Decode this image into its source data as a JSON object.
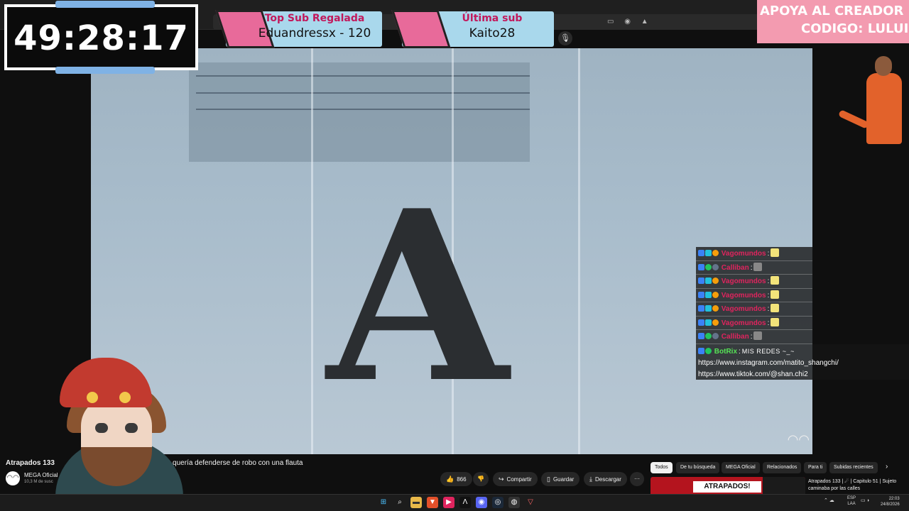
{
  "timer": {
    "value": "49:28:17"
  },
  "top_sub": {
    "title": "Top Sub Regalada",
    "name": "Eduandressx - 120"
  },
  "last_sub": {
    "title": "Última sub",
    "name": "Kaito28"
  },
  "creator_banner": {
    "line1": "APOYA AL CREADOR",
    "line2": "CODIGO: LULUI"
  },
  "video": {
    "letter": "A",
    "logo_icon": "mega-logo-icon"
  },
  "chat": {
    "rows": [
      {
        "user": "Vagomundos",
        "sep": ":"
      },
      {
        "user": "Calliban",
        "sep": ":"
      },
      {
        "user": "Vagomundos",
        "sep": ":"
      },
      {
        "user": "Vagomundos",
        "sep": ":"
      },
      {
        "user": "Vagomundos",
        "sep": ":"
      },
      {
        "user": "Vagomundos",
        "sep": ":"
      },
      {
        "user": "Calliban",
        "sep": ":"
      }
    ],
    "bot": {
      "user": "BotRix",
      "sep": ":",
      "message": "MIS REDES ~_~",
      "link1": "https://www.instagram.com/matito_shangchi/",
      "link2": "https://www.tiktok.com/@shan.chi2"
    }
  },
  "youtube": {
    "title": "Atrapados 133",
    "description": "callejero quería defenderse de robo con una flauta",
    "channel": "MEGA Oficial",
    "subscribers": "10,3 M de susc",
    "likes": "866",
    "share": "Compartir",
    "save": "Guardar",
    "download": "Descargar",
    "more": "···",
    "chips": [
      "Todos",
      "De tu búsqueda",
      "MEGA Oficial",
      "Relacionados",
      "Para ti",
      "Subidas recientes"
    ],
    "thumb_banner": "ATRAPADOS!",
    "rec_title": "Atrapados 133 | ☄ | Capitulo 51 | Sujeto caminaba por las calles"
  },
  "taskbar": {
    "lang1": "ESP",
    "lang2": "LAA",
    "time": "22:03",
    "date": "24/8/2026"
  },
  "colors": {
    "accent_pink": "#e86a9a",
    "card_blue": "#a9d8ec",
    "chat_user": "#e0245e",
    "bot_user": "#56e356"
  }
}
